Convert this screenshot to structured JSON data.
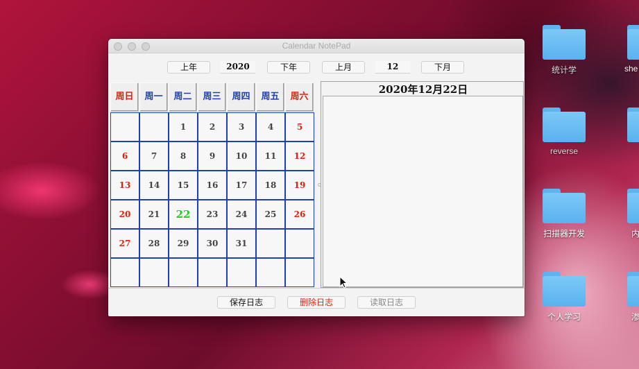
{
  "desktop": {
    "icons": [
      {
        "label": "统计学"
      },
      {
        "label": "she"
      },
      {
        "label": "reverse"
      },
      {
        "label": "扫描器开发"
      },
      {
        "label": "内"
      },
      {
        "label": "个人学习"
      },
      {
        "label": "渗"
      }
    ]
  },
  "window": {
    "title": "Calendar NotePad"
  },
  "nav": {
    "prev_year": "上年",
    "year": "2020",
    "next_year": "下年",
    "prev_month": "上月",
    "month": "12",
    "next_month": "下月"
  },
  "calendar": {
    "weekdays": [
      "周日",
      "周一",
      "周二",
      "周三",
      "周四",
      "周五",
      "周六"
    ],
    "weekday_colors": [
      "#e0200f",
      "#1f3fb5",
      "#1f3fb5",
      "#1f3fb5",
      "#1f3fb5",
      "#1f3fb5",
      "#e0200f"
    ],
    "today": "22",
    "rows": [
      [
        "",
        "",
        "1",
        "2",
        "3",
        "4",
        "5"
      ],
      [
        "6",
        "7",
        "8",
        "9",
        "10",
        "11",
        "12"
      ],
      [
        "13",
        "14",
        "15",
        "16",
        "17",
        "18",
        "19"
      ],
      [
        "20",
        "21",
        "22",
        "23",
        "24",
        "25",
        "26"
      ],
      [
        "27",
        "28",
        "29",
        "30",
        "31",
        "",
        ""
      ],
      [
        "",
        "",
        "",
        "",
        "",
        "",
        ""
      ]
    ]
  },
  "notes": {
    "date_title": "2020年12月22日",
    "content": ""
  },
  "actions": {
    "save": "保存日志",
    "delete": "删除日志",
    "read": "读取日志"
  },
  "colors": {
    "weekend": "#e0200f",
    "weekday": "#1f3fb5",
    "today": "#22cc22",
    "delete_text": "#e0200f",
    "disabled_text": "#888888"
  }
}
